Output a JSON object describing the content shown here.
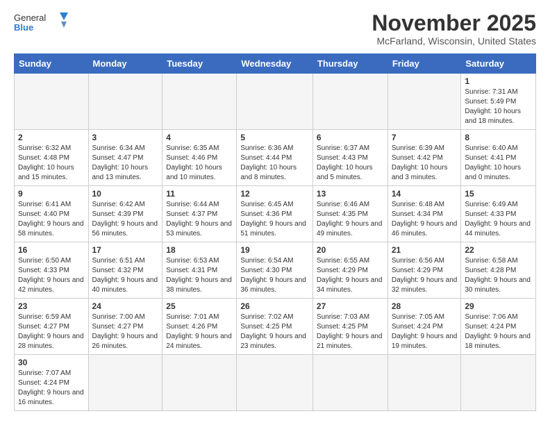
{
  "header": {
    "logo_general": "General",
    "logo_blue": "Blue",
    "month_year": "November 2025",
    "location": "McFarland, Wisconsin, United States"
  },
  "days_of_week": [
    "Sunday",
    "Monday",
    "Tuesday",
    "Wednesday",
    "Thursday",
    "Friday",
    "Saturday"
  ],
  "weeks": [
    [
      {
        "day": "",
        "info": ""
      },
      {
        "day": "",
        "info": ""
      },
      {
        "day": "",
        "info": ""
      },
      {
        "day": "",
        "info": ""
      },
      {
        "day": "",
        "info": ""
      },
      {
        "day": "",
        "info": ""
      },
      {
        "day": "1",
        "info": "Sunrise: 7:31 AM\nSunset: 5:49 PM\nDaylight: 10 hours and 18 minutes."
      }
    ],
    [
      {
        "day": "2",
        "info": "Sunrise: 6:32 AM\nSunset: 4:48 PM\nDaylight: 10 hours and 15 minutes."
      },
      {
        "day": "3",
        "info": "Sunrise: 6:34 AM\nSunset: 4:47 PM\nDaylight: 10 hours and 13 minutes."
      },
      {
        "day": "4",
        "info": "Sunrise: 6:35 AM\nSunset: 4:46 PM\nDaylight: 10 hours and 10 minutes."
      },
      {
        "day": "5",
        "info": "Sunrise: 6:36 AM\nSunset: 4:44 PM\nDaylight: 10 hours and 8 minutes."
      },
      {
        "day": "6",
        "info": "Sunrise: 6:37 AM\nSunset: 4:43 PM\nDaylight: 10 hours and 5 minutes."
      },
      {
        "day": "7",
        "info": "Sunrise: 6:39 AM\nSunset: 4:42 PM\nDaylight: 10 hours and 3 minutes."
      },
      {
        "day": "8",
        "info": "Sunrise: 6:40 AM\nSunset: 4:41 PM\nDaylight: 10 hours and 0 minutes."
      }
    ],
    [
      {
        "day": "9",
        "info": "Sunrise: 6:41 AM\nSunset: 4:40 PM\nDaylight: 9 hours and 58 minutes."
      },
      {
        "day": "10",
        "info": "Sunrise: 6:42 AM\nSunset: 4:39 PM\nDaylight: 9 hours and 56 minutes."
      },
      {
        "day": "11",
        "info": "Sunrise: 6:44 AM\nSunset: 4:37 PM\nDaylight: 9 hours and 53 minutes."
      },
      {
        "day": "12",
        "info": "Sunrise: 6:45 AM\nSunset: 4:36 PM\nDaylight: 9 hours and 51 minutes."
      },
      {
        "day": "13",
        "info": "Sunrise: 6:46 AM\nSunset: 4:35 PM\nDaylight: 9 hours and 49 minutes."
      },
      {
        "day": "14",
        "info": "Sunrise: 6:48 AM\nSunset: 4:34 PM\nDaylight: 9 hours and 46 minutes."
      },
      {
        "day": "15",
        "info": "Sunrise: 6:49 AM\nSunset: 4:33 PM\nDaylight: 9 hours and 44 minutes."
      }
    ],
    [
      {
        "day": "16",
        "info": "Sunrise: 6:50 AM\nSunset: 4:33 PM\nDaylight: 9 hours and 42 minutes."
      },
      {
        "day": "17",
        "info": "Sunrise: 6:51 AM\nSunset: 4:32 PM\nDaylight: 9 hours and 40 minutes."
      },
      {
        "day": "18",
        "info": "Sunrise: 6:53 AM\nSunset: 4:31 PM\nDaylight: 9 hours and 38 minutes."
      },
      {
        "day": "19",
        "info": "Sunrise: 6:54 AM\nSunset: 4:30 PM\nDaylight: 9 hours and 36 minutes."
      },
      {
        "day": "20",
        "info": "Sunrise: 6:55 AM\nSunset: 4:29 PM\nDaylight: 9 hours and 34 minutes."
      },
      {
        "day": "21",
        "info": "Sunrise: 6:56 AM\nSunset: 4:29 PM\nDaylight: 9 hours and 32 minutes."
      },
      {
        "day": "22",
        "info": "Sunrise: 6:58 AM\nSunset: 4:28 PM\nDaylight: 9 hours and 30 minutes."
      }
    ],
    [
      {
        "day": "23",
        "info": "Sunrise: 6:59 AM\nSunset: 4:27 PM\nDaylight: 9 hours and 28 minutes."
      },
      {
        "day": "24",
        "info": "Sunrise: 7:00 AM\nSunset: 4:27 PM\nDaylight: 9 hours and 26 minutes."
      },
      {
        "day": "25",
        "info": "Sunrise: 7:01 AM\nSunset: 4:26 PM\nDaylight: 9 hours and 24 minutes."
      },
      {
        "day": "26",
        "info": "Sunrise: 7:02 AM\nSunset: 4:25 PM\nDaylight: 9 hours and 23 minutes."
      },
      {
        "day": "27",
        "info": "Sunrise: 7:03 AM\nSunset: 4:25 PM\nDaylight: 9 hours and 21 minutes."
      },
      {
        "day": "28",
        "info": "Sunrise: 7:05 AM\nSunset: 4:24 PM\nDaylight: 9 hours and 19 minutes."
      },
      {
        "day": "29",
        "info": "Sunrise: 7:06 AM\nSunset: 4:24 PM\nDaylight: 9 hours and 18 minutes."
      }
    ],
    [
      {
        "day": "30",
        "info": "Sunrise: 7:07 AM\nSunset: 4:24 PM\nDaylight: 9 hours and 16 minutes."
      },
      {
        "day": "",
        "info": ""
      },
      {
        "day": "",
        "info": ""
      },
      {
        "day": "",
        "info": ""
      },
      {
        "day": "",
        "info": ""
      },
      {
        "day": "",
        "info": ""
      },
      {
        "day": "",
        "info": ""
      }
    ]
  ]
}
